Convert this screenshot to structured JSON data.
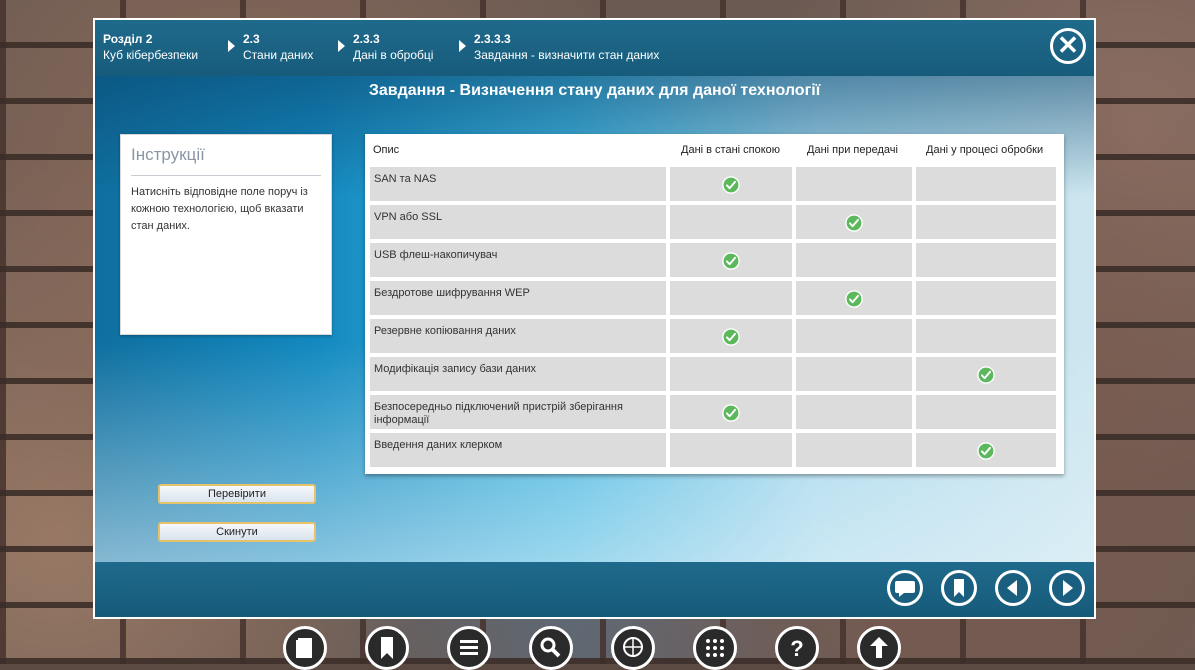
{
  "header": {
    "crumbs": [
      {
        "num": "Розділ 2",
        "text": "Куб кібербезпеки"
      },
      {
        "num": "2.3",
        "text": "Стани даних"
      },
      {
        "num": "2.3.3",
        "text": "Дані в обробці"
      },
      {
        "num": "2.3.3.3",
        "text": "Завдання - визначити стан даних"
      }
    ],
    "close_icon": "close-icon"
  },
  "main": {
    "title": "Завдання - Визначення стану даних для даної технології",
    "instructions": {
      "heading": "Інструкції",
      "text": "Натисніть відповідне поле поруч із кожною технологією, щоб вказати стан даних."
    },
    "buttons": {
      "check": "Перевірити",
      "reset": "Скинути"
    },
    "table": {
      "headers": [
        "Опис",
        "Дані в стані спокою",
        "Дані при передачі",
        "Дані у процесі обробки"
      ],
      "rows": [
        {
          "desc": "SAN та NAS",
          "state": 1
        },
        {
          "desc": "VPN або SSL",
          "state": 2
        },
        {
          "desc": "USB флеш-накопичувач",
          "state": 1
        },
        {
          "desc": "Бездротове шифрування WEP",
          "state": 2
        },
        {
          "desc": "Резервне копіювання даних",
          "state": 1
        },
        {
          "desc": "Модифікація запису бази даних",
          "state": 3
        },
        {
          "desc": "Безпосередньо підключений пристрій зберігання інформації",
          "state": 1
        },
        {
          "desc": "Введення даних клерком",
          "state": 3
        }
      ]
    },
    "check_color": "#5cb85c"
  },
  "footer": {
    "icons": [
      "comment-icon",
      "bookmark-icon",
      "previous-icon",
      "next-icon"
    ]
  },
  "dock": {
    "icons": [
      "book-icon",
      "bookmark-icon",
      "menu-icon",
      "search-icon",
      "glossary-icon",
      "grid-icon",
      "help-icon",
      "upload-icon"
    ]
  }
}
